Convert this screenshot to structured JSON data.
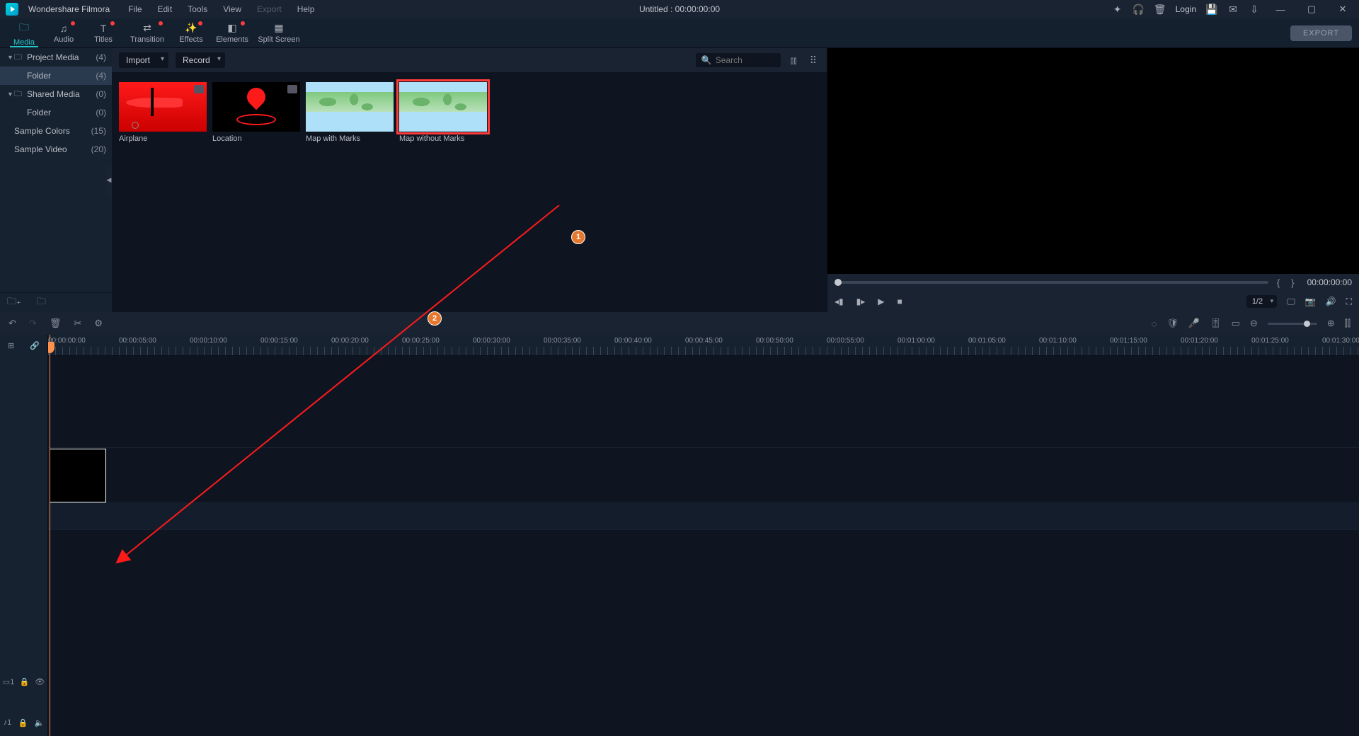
{
  "titlebar": {
    "brand": "Wondershare Filmora",
    "menus": [
      "File",
      "Edit",
      "Tools",
      "View",
      "Export",
      "Help"
    ],
    "disabled_menu": "Export",
    "title_center": "Untitled : 00:00:00:00",
    "login": "Login"
  },
  "ribbon": {
    "tabs": [
      {
        "label": "Media",
        "active": true,
        "dot": false
      },
      {
        "label": "Audio",
        "active": false,
        "dot": true
      },
      {
        "label": "Titles",
        "active": false,
        "dot": true
      },
      {
        "label": "Transition",
        "active": false,
        "dot": true
      },
      {
        "label": "Effects",
        "active": false,
        "dot": true
      },
      {
        "label": "Elements",
        "active": false,
        "dot": true
      },
      {
        "label": "Split Screen",
        "active": false,
        "dot": false
      }
    ],
    "export": "EXPORT"
  },
  "sidebar": {
    "items": [
      {
        "label": "Project Media",
        "count": "(4)",
        "arrow": true,
        "folder": true,
        "sel": false,
        "indent": false
      },
      {
        "label": "Folder",
        "count": "(4)",
        "arrow": false,
        "folder": false,
        "sel": true,
        "indent": true
      },
      {
        "label": "Shared Media",
        "count": "(0)",
        "arrow": true,
        "folder": true,
        "sel": false,
        "indent": false
      },
      {
        "label": "Folder",
        "count": "(0)",
        "arrow": false,
        "folder": false,
        "sel": false,
        "indent": true
      },
      {
        "label": "Sample Colors",
        "count": "(15)",
        "arrow": false,
        "folder": false,
        "sel": false,
        "indent": false
      },
      {
        "label": "Sample Video",
        "count": "(20)",
        "arrow": false,
        "folder": false,
        "sel": false,
        "indent": false
      }
    ]
  },
  "media_toolbar": {
    "import": "Import",
    "record": "Record",
    "search_placeholder": "Search"
  },
  "media_items": [
    {
      "label": "Airplane",
      "kind": "airplane",
      "badge": true,
      "circle": true,
      "selected": false
    },
    {
      "label": "Location",
      "kind": "location",
      "badge": true,
      "circle": false,
      "selected": false
    },
    {
      "label": "Map with Marks",
      "kind": "map",
      "badge": false,
      "circle": false,
      "selected": false
    },
    {
      "label": "Map without Marks",
      "kind": "map",
      "badge": false,
      "circle": false,
      "selected": true
    }
  ],
  "callouts": {
    "one": "1",
    "two": "2"
  },
  "preview": {
    "timecode": "00:00:00:00",
    "ratio": "1/2"
  },
  "ruler_start": "00:00:00:00",
  "ruler_step_sec": 5,
  "ruler_count": 19,
  "track_labels": {
    "video": "1",
    "audio": "1"
  }
}
